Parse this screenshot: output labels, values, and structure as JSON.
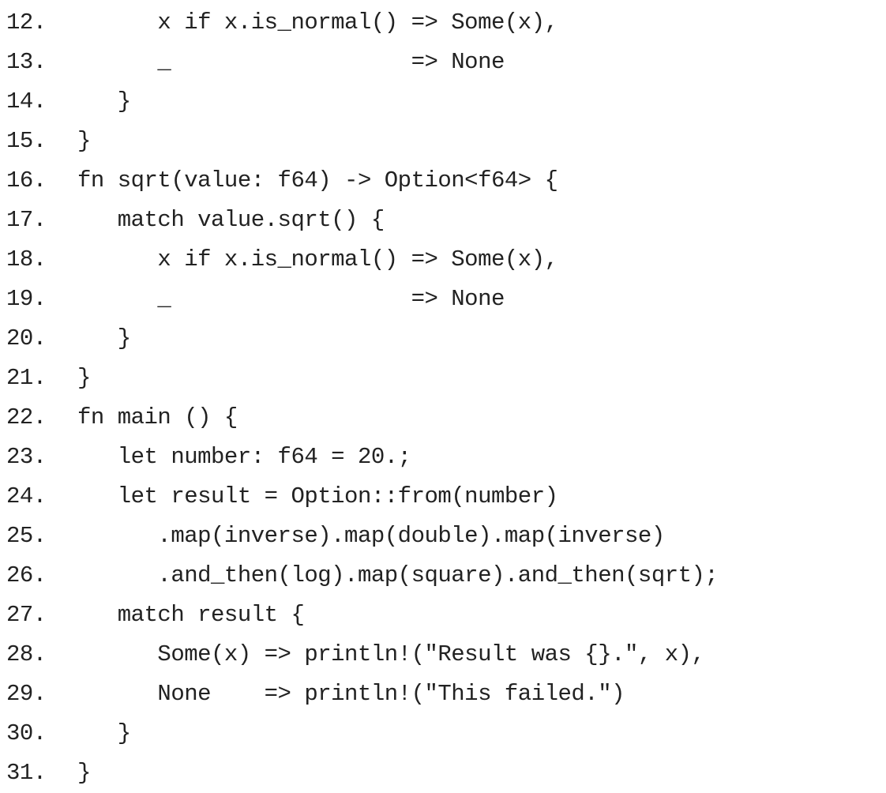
{
  "listing": {
    "lines": [
      {
        "num": "12.",
        "text": "      x if x.is_normal() => Some(x),"
      },
      {
        "num": "13.",
        "text": "      _                  => None"
      },
      {
        "num": "14.",
        "text": "   }"
      },
      {
        "num": "15.",
        "text": "}"
      },
      {
        "num": "16.",
        "text": "fn sqrt(value: f64) -> Option<f64> {"
      },
      {
        "num": "17.",
        "text": "   match value.sqrt() {"
      },
      {
        "num": "18.",
        "text": "      x if x.is_normal() => Some(x),"
      },
      {
        "num": "19.",
        "text": "      _                  => None"
      },
      {
        "num": "20.",
        "text": "   }"
      },
      {
        "num": "21.",
        "text": "}"
      },
      {
        "num": "22.",
        "text": "fn main () {"
      },
      {
        "num": "23.",
        "text": "   let number: f64 = 20.;"
      },
      {
        "num": "24.",
        "text": "   let result = Option::from(number)"
      },
      {
        "num": "25.",
        "text": "      .map(inverse).map(double).map(inverse)"
      },
      {
        "num": "26.",
        "text": "      .and_then(log).map(square).and_then(sqrt);"
      },
      {
        "num": "27.",
        "text": "   match result {"
      },
      {
        "num": "28.",
        "text": "      Some(x) => println!(\"Result was {}.\", x),"
      },
      {
        "num": "29.",
        "text": "      None    => println!(\"This failed.\")"
      },
      {
        "num": "30.",
        "text": "   }"
      },
      {
        "num": "31.",
        "text": "}"
      }
    ]
  }
}
